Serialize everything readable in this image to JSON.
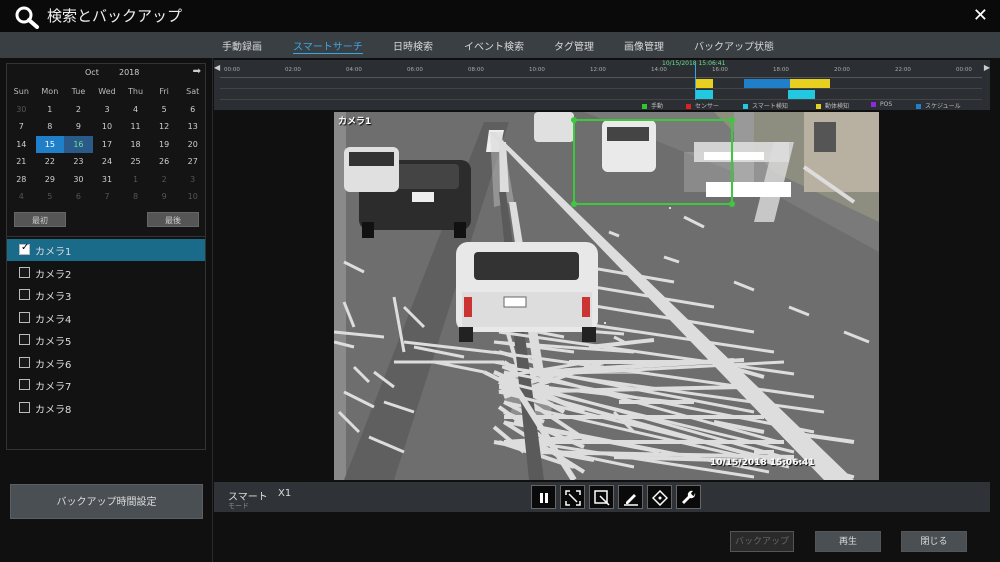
{
  "title": "検索とバックアップ",
  "tabs": [
    {
      "label": "手動録画",
      "active": false
    },
    {
      "label": "スマートサーチ",
      "active": true
    },
    {
      "label": "日時検索",
      "active": false
    },
    {
      "label": "イベント検索",
      "active": false
    },
    {
      "label": "タグ管理",
      "active": false
    },
    {
      "label": "画像管理",
      "active": false
    },
    {
      "label": "バックアップ状態",
      "active": false
    }
  ],
  "calendar": {
    "month": "Oct",
    "year": "2018",
    "weekdays": [
      "Sun",
      "Mon",
      "Tue",
      "Wed",
      "Thu",
      "Fri",
      "Sat"
    ],
    "weeks": [
      [
        "30",
        "1",
        "2",
        "3",
        "4",
        "5",
        "6"
      ],
      [
        "7",
        "8",
        "9",
        "10",
        "11",
        "12",
        "13"
      ],
      [
        "14",
        "15",
        "16",
        "17",
        "18",
        "19",
        "20"
      ],
      [
        "21",
        "22",
        "23",
        "24",
        "25",
        "26",
        "27"
      ],
      [
        "28",
        "29",
        "30",
        "31",
        "1",
        "2",
        "3"
      ],
      [
        "4",
        "5",
        "6",
        "7",
        "8",
        "9",
        "10"
      ]
    ],
    "selected_day": "15",
    "recorded_day": "16",
    "first_label": "最初",
    "last_label": "最後"
  },
  "cameras": [
    {
      "label": "カメラ1",
      "checked": true
    },
    {
      "label": "カメラ2",
      "checked": false
    },
    {
      "label": "カメラ3",
      "checked": false
    },
    {
      "label": "カメラ4",
      "checked": false
    },
    {
      "label": "カメラ5",
      "checked": false
    },
    {
      "label": "カメラ6",
      "checked": false
    },
    {
      "label": "カメラ7",
      "checked": false
    },
    {
      "label": "カメラ8",
      "checked": false
    }
  ],
  "backup_time_setting": "バックアップ時間設定",
  "timeline": {
    "hours": [
      "00:00",
      "02:00",
      "04:00",
      "06:00",
      "08:00",
      "10:00",
      "12:00",
      "14:00",
      "16:00",
      "18:00",
      "20:00",
      "22:00",
      "00:00"
    ],
    "current_time": "10/15/2018 15:06:41"
  },
  "legend": [
    {
      "label": "手動",
      "color": "#2ec82e"
    },
    {
      "label": "センサー",
      "color": "#e02020"
    },
    {
      "label": "スマート検知",
      "color": "#20c8e0"
    },
    {
      "label": "動体検知",
      "color": "#e8d020"
    },
    {
      "label": "POS",
      "color": "#8a2be2"
    },
    {
      "label": "スケジュール",
      "color": "#1f7fc8"
    }
  ],
  "video": {
    "camera_label": "カメラ1",
    "timestamp": "10/15/2018 15:06:41"
  },
  "controls": {
    "mode_label": "スマート",
    "mode_sub": "モード",
    "speed": "X1"
  },
  "actions": {
    "backup": "バックアップ",
    "play": "再生",
    "close": "閉じる"
  },
  "colors": {
    "accent": "#3aa8e0",
    "detect_box": "#3ec83e"
  }
}
